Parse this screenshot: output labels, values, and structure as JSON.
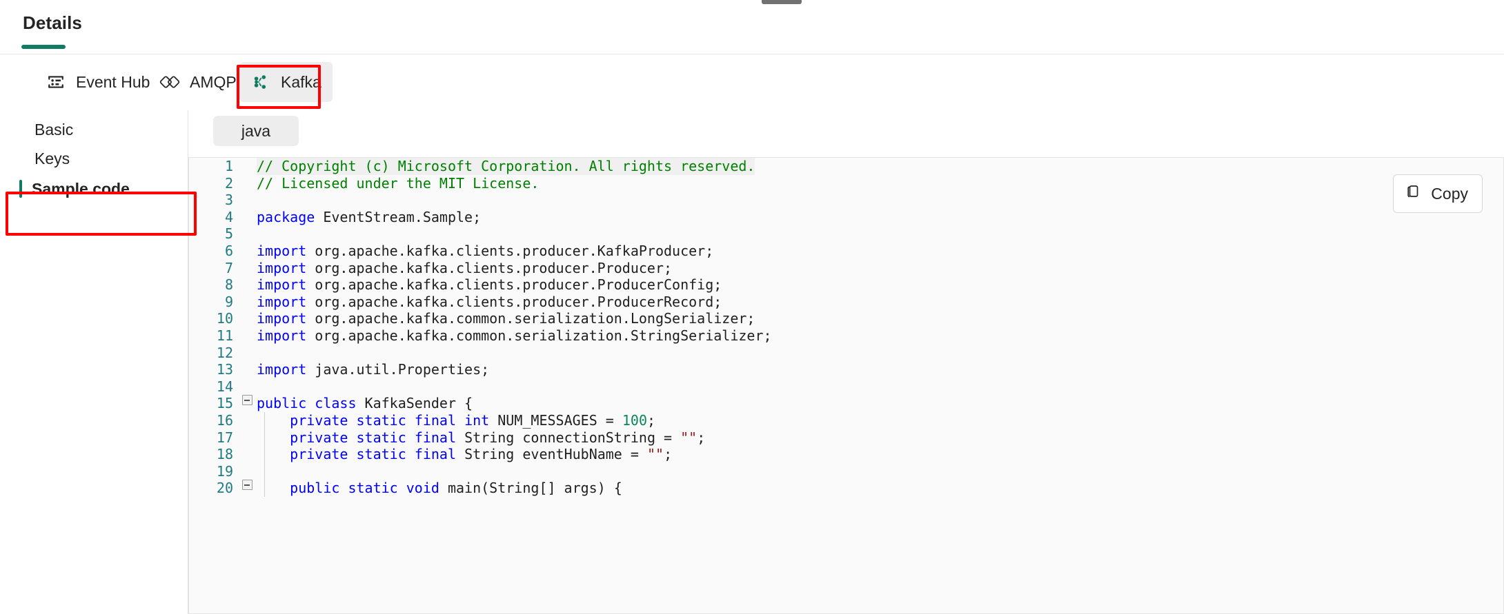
{
  "window": {
    "drag_handle": "drag-handle"
  },
  "header": {
    "tab_label": "Details",
    "accent_color": "#107C63"
  },
  "pivots": [
    {
      "id": "event-hub",
      "label": "Event Hub",
      "icon": "event-hub-icon",
      "selected": false
    },
    {
      "id": "amqp",
      "label": "AMQP",
      "icon": "amqp-icon",
      "selected": false
    },
    {
      "id": "kafka",
      "label": "Kafka",
      "icon": "kafka-icon",
      "selected": true
    }
  ],
  "sidebar": {
    "items": [
      {
        "id": "basic",
        "label": "Basic",
        "selected": false
      },
      {
        "id": "keys",
        "label": "Keys",
        "selected": false
      },
      {
        "id": "sample-code",
        "label": "Sample code",
        "selected": true
      }
    ]
  },
  "main": {
    "language_pill": "java",
    "copy_button": "Copy",
    "copy_icon": "copy-icon"
  },
  "annotations": [
    {
      "id": "kafka-highlight",
      "color": "#FF0000",
      "target": "kafka-pivot"
    },
    {
      "id": "sample-code-highlight",
      "color": "#FF0000",
      "target": "sidebar-item-sample-code"
    }
  ],
  "code": {
    "language": "java",
    "first_line_highlighted": true,
    "lines": [
      {
        "n": "1",
        "fold": "",
        "indent": false,
        "tokens": [
          {
            "t": "// Copyright (c) Microsoft Corporation. All rights reserved.",
            "c": "tk-cmt"
          }
        ]
      },
      {
        "n": "2",
        "fold": "",
        "indent": false,
        "tokens": [
          {
            "t": "// Licensed under the MIT License.",
            "c": "tk-cmt"
          }
        ]
      },
      {
        "n": "3",
        "fold": "",
        "indent": false,
        "tokens": []
      },
      {
        "n": "4",
        "fold": "",
        "indent": false,
        "tokens": [
          {
            "t": "package",
            "c": "tk-kw"
          },
          {
            "t": " EventStream.Sample;",
            "c": "tk-pln"
          }
        ]
      },
      {
        "n": "5",
        "fold": "",
        "indent": false,
        "tokens": []
      },
      {
        "n": "6",
        "fold": "",
        "indent": false,
        "tokens": [
          {
            "t": "import",
            "c": "tk-kw"
          },
          {
            "t": " org.apache.kafka.clients.producer.KafkaProducer;",
            "c": "tk-pln"
          }
        ]
      },
      {
        "n": "7",
        "fold": "",
        "indent": false,
        "tokens": [
          {
            "t": "import",
            "c": "tk-kw"
          },
          {
            "t": " org.apache.kafka.clients.producer.Producer;",
            "c": "tk-pln"
          }
        ]
      },
      {
        "n": "8",
        "fold": "",
        "indent": false,
        "tokens": [
          {
            "t": "import",
            "c": "tk-kw"
          },
          {
            "t": " org.apache.kafka.clients.producer.ProducerConfig;",
            "c": "tk-pln"
          }
        ]
      },
      {
        "n": "9",
        "fold": "",
        "indent": false,
        "tokens": [
          {
            "t": "import",
            "c": "tk-kw"
          },
          {
            "t": " org.apache.kafka.clients.producer.ProducerRecord;",
            "c": "tk-pln"
          }
        ]
      },
      {
        "n": "10",
        "fold": "",
        "indent": false,
        "tokens": [
          {
            "t": "import",
            "c": "tk-kw"
          },
          {
            "t": " org.apache.kafka.common.serialization.LongSerializer;",
            "c": "tk-pln"
          }
        ]
      },
      {
        "n": "11",
        "fold": "",
        "indent": false,
        "tokens": [
          {
            "t": "import",
            "c": "tk-kw"
          },
          {
            "t": " org.apache.kafka.common.serialization.StringSerializer;",
            "c": "tk-pln"
          }
        ]
      },
      {
        "n": "12",
        "fold": "",
        "indent": false,
        "tokens": []
      },
      {
        "n": "13",
        "fold": "",
        "indent": false,
        "tokens": [
          {
            "t": "import",
            "c": "tk-kw"
          },
          {
            "t": " java.util.Properties;",
            "c": "tk-pln"
          }
        ]
      },
      {
        "n": "14",
        "fold": "",
        "indent": false,
        "tokens": []
      },
      {
        "n": "15",
        "fold": "minus",
        "indent": false,
        "tokens": [
          {
            "t": "public",
            "c": "tk-kw"
          },
          {
            "t": " ",
            "c": "tk-pln"
          },
          {
            "t": "class",
            "c": "tk-kw"
          },
          {
            "t": " KafkaSender {",
            "c": "tk-pln"
          }
        ]
      },
      {
        "n": "16",
        "fold": "",
        "indent": true,
        "tokens": [
          {
            "t": "    ",
            "c": "tk-pln"
          },
          {
            "t": "private",
            "c": "tk-kw"
          },
          {
            "t": " ",
            "c": "tk-pln"
          },
          {
            "t": "static",
            "c": "tk-kw"
          },
          {
            "t": " ",
            "c": "tk-pln"
          },
          {
            "t": "final",
            "c": "tk-kw"
          },
          {
            "t": " ",
            "c": "tk-pln"
          },
          {
            "t": "int",
            "c": "tk-kw"
          },
          {
            "t": " NUM_MESSAGES = ",
            "c": "tk-pln"
          },
          {
            "t": "100",
            "c": "tk-num"
          },
          {
            "t": ";",
            "c": "tk-pln"
          }
        ]
      },
      {
        "n": "17",
        "fold": "",
        "indent": true,
        "tokens": [
          {
            "t": "    ",
            "c": "tk-pln"
          },
          {
            "t": "private",
            "c": "tk-kw"
          },
          {
            "t": " ",
            "c": "tk-pln"
          },
          {
            "t": "static",
            "c": "tk-kw"
          },
          {
            "t": " ",
            "c": "tk-pln"
          },
          {
            "t": "final",
            "c": "tk-kw"
          },
          {
            "t": " String connectionString = ",
            "c": "tk-pln"
          },
          {
            "t": "\"\"",
            "c": "tk-str"
          },
          {
            "t": ";",
            "c": "tk-pln"
          }
        ]
      },
      {
        "n": "18",
        "fold": "",
        "indent": true,
        "tokens": [
          {
            "t": "    ",
            "c": "tk-pln"
          },
          {
            "t": "private",
            "c": "tk-kw"
          },
          {
            "t": " ",
            "c": "tk-pln"
          },
          {
            "t": "static",
            "c": "tk-kw"
          },
          {
            "t": " ",
            "c": "tk-pln"
          },
          {
            "t": "final",
            "c": "tk-kw"
          },
          {
            "t": " String eventHubName = ",
            "c": "tk-pln"
          },
          {
            "t": "\"\"",
            "c": "tk-str"
          },
          {
            "t": ";",
            "c": "tk-pln"
          }
        ]
      },
      {
        "n": "19",
        "fold": "",
        "indent": true,
        "tokens": []
      },
      {
        "n": "20",
        "fold": "minus",
        "indent": true,
        "tokens": [
          {
            "t": "    ",
            "c": "tk-pln"
          },
          {
            "t": "public",
            "c": "tk-kw"
          },
          {
            "t": " ",
            "c": "tk-pln"
          },
          {
            "t": "static",
            "c": "tk-kw"
          },
          {
            "t": " ",
            "c": "tk-pln"
          },
          {
            "t": "void",
            "c": "tk-kw"
          },
          {
            "t": " main(String[] args) {",
            "c": "tk-pln"
          }
        ]
      }
    ]
  }
}
